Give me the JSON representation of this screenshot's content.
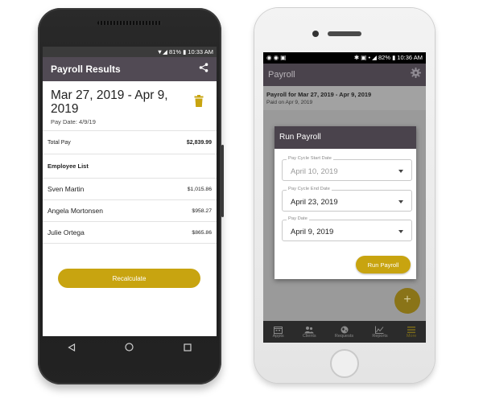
{
  "android": {
    "status_text": "▼◢ 81% ▮ 10:33 AM",
    "appbar": {
      "title": "Payroll Results"
    },
    "summary": {
      "date_range": "Mar 27, 2019 - Apr 9, 2019",
      "pay_date": "Pay Date: 4/9/19"
    },
    "total": {
      "label": "Total Pay",
      "amount": "$2,839.99"
    },
    "employee_section": "Employee List",
    "employees": [
      {
        "name": "Sven Martin",
        "amount": "$1,015.86"
      },
      {
        "name": "Angela Mortonsen",
        "amount": "$958.27"
      },
      {
        "name": "Julie Ortega",
        "amount": "$865.86"
      }
    ],
    "recalculate_label": "Recalculate",
    "colors": {
      "accent": "#c8a410",
      "appbar": "#514a54",
      "trash": "#c8a410"
    }
  },
  "iphone": {
    "status": {
      "left_icons": "◉ ◉ ▣",
      "right_text": "✱ ▣ • ◢ 82% ▮ 10:36 AM"
    },
    "appbar": {
      "title": "Payroll"
    },
    "list_item": {
      "title": "Payroll for Mar 27, 2019 - Apr 9, 2019",
      "subtitle": "Paid on Apr 9, 2019"
    },
    "dialog": {
      "title": "Run Payroll",
      "start": {
        "label": "Pay Cycle Start Date",
        "value": "April 10, 2019"
      },
      "end": {
        "label": "Pay Cycle End Date",
        "value": "April 23, 2019"
      },
      "paydate": {
        "label": "Pay Date",
        "value": "April 9, 2019"
      },
      "run_label": "Run Payroll"
    },
    "fab_label": "+",
    "tabs": [
      {
        "label": "Appts",
        "icon": "calendar-icon"
      },
      {
        "label": "Clients",
        "icon": "people-icon"
      },
      {
        "label": "Requests",
        "icon": "globe-icon"
      },
      {
        "label": "Reports",
        "icon": "chart-icon"
      },
      {
        "label": "More",
        "icon": "menu-icon"
      }
    ],
    "colors": {
      "accent": "#c8a410",
      "appbar": "#4a434c"
    }
  }
}
